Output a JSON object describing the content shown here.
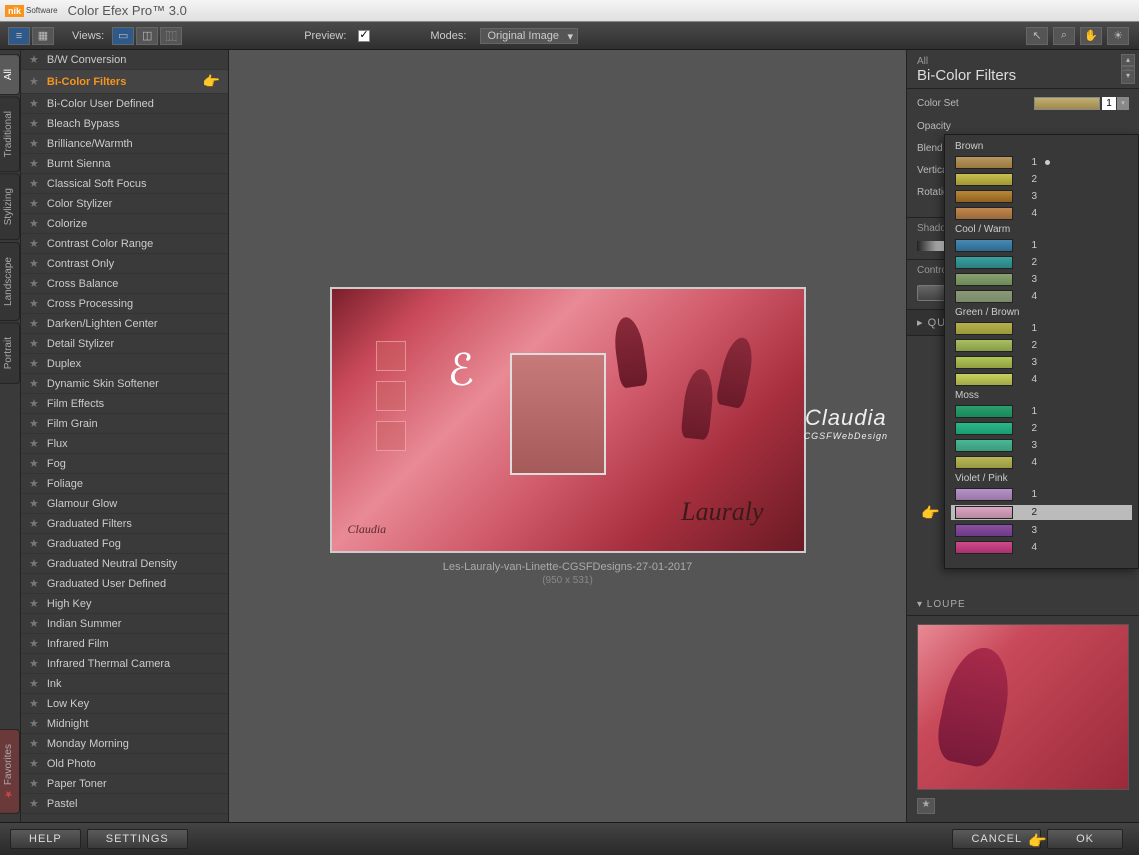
{
  "title": {
    "app": "Color Efex Pro™ 3.0",
    "brand": "nik",
    "brand_sub": "Software"
  },
  "toolbar": {
    "views": "Views:",
    "preview": "Preview:",
    "modes": "Modes:",
    "modes_selected": "Original Image"
  },
  "vtabs": {
    "all": "All",
    "traditional": "Traditional",
    "stylizing": "Stylizing",
    "landscape": "Landscape",
    "portrait": "Portrait",
    "favorites": "Favorites"
  },
  "filters": [
    "B/W Conversion",
    "Bi-Color Filters",
    "Bi-Color User Defined",
    "Bleach Bypass",
    "Brilliance/Warmth",
    "Burnt Sienna",
    "Classical Soft Focus",
    "Color Stylizer",
    "Colorize",
    "Contrast Color Range",
    "Contrast Only",
    "Cross Balance",
    "Cross Processing",
    "Darken/Lighten Center",
    "Detail Stylizer",
    "Duplex",
    "Dynamic Skin Softener",
    "Film Effects",
    "Film Grain",
    "Flux",
    "Fog",
    "Foliage",
    "Glamour Glow",
    "Graduated Filters",
    "Graduated Fog",
    "Graduated Neutral Density",
    "Graduated User Defined",
    "High Key",
    "Indian Summer",
    "Infrared Film",
    "Infrared Thermal Camera",
    "Ink",
    "Low Key",
    "Midnight",
    "Monday Morning",
    "Old Photo",
    "Paper Toner",
    "Pastel"
  ],
  "filter_selected_index": 1,
  "canvas": {
    "caption": "Les-Lauraly-van-Linette-CGSFDesigns-27-01-2017",
    "size": "(950 x 531)",
    "sig1": "Lauraly",
    "sig2": "Claudia",
    "watermark": "Claudia",
    "watermark_sub": "CGSFWebDesign"
  },
  "right": {
    "all": "All",
    "title": "Bi-Color Filters",
    "p_colorset": "Color Set",
    "p_colorset_num": "1",
    "p_opacity": "Opacity",
    "p_blend": "Blend",
    "p_vshift": "Vertical Shift",
    "p_rotation": "Rotation",
    "sec_shadows": "Shadows / Highlights",
    "sec_cp": "Control Points",
    "quicksave": "▸ QUICK SAVE",
    "loupe": "▾ LOUPE"
  },
  "popup": {
    "groups": [
      {
        "name": "Brown",
        "swatches": [
          "#b89860:#9a7840",
          "#c8c050:#a09830",
          "#b88838:#906020",
          "#c08850:#9a6838"
        ]
      },
      {
        "name": "Cool / Warm",
        "swatches": [
          "#4a8ab0:#2a6a90",
          "#3aa0a0:#2a8080",
          "#8aa070:#6a8a58",
          "#8a9a78:#788a68"
        ]
      },
      {
        "name": "Green / Brown",
        "swatches": [
          "#b8b050:#9a9838",
          "#a8c060:#889a48",
          "#b0c858:#90a040",
          "#c8d060:#a0a848"
        ]
      },
      {
        "name": "Moss",
        "swatches": [
          "#2aa070:#1a8858",
          "#2ab888:#1a9a70",
          "#4ab898:#3a9a78",
          "#b8b858:#989840"
        ]
      },
      {
        "name": "Violet / Pink",
        "swatches": [
          "#b890c8:#9878a8",
          "#d8a8c0:#b888a0",
          "#8850a0:#703888",
          "#d04a8a:#a83070"
        ]
      }
    ],
    "selected_group": 4,
    "selected_swatch": 1
  },
  "bottom": {
    "help": "HELP",
    "settings": "SETTINGS",
    "cancel": "CANCEL",
    "ok": "OK"
  }
}
